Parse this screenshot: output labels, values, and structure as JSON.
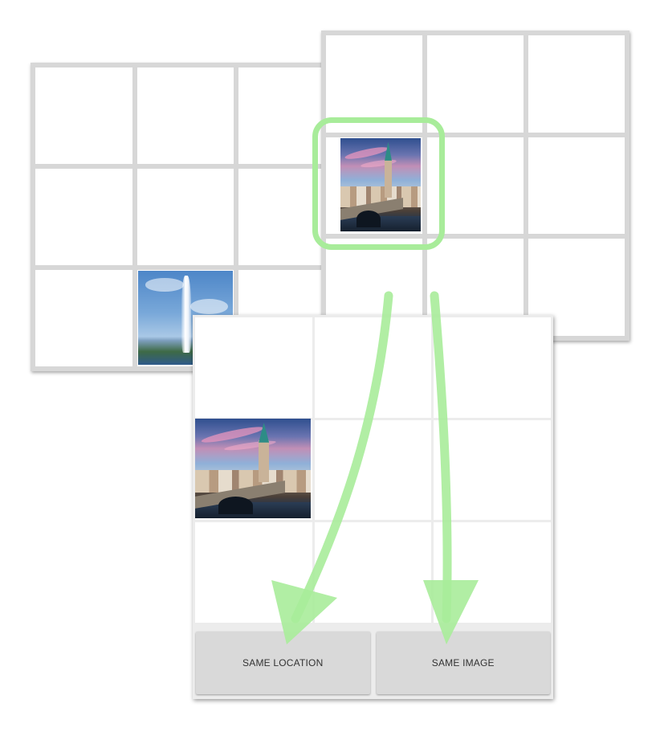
{
  "buttons": {
    "same_location_label": "SAME LOCATION",
    "same_image_label": "SAME IMAGE"
  },
  "colors": {
    "highlight": "#a8ec9a",
    "board_border": "#d7d7d7",
    "button_bg": "#d9d9d9"
  },
  "boards": {
    "left": {
      "rows": 3,
      "cols": 3,
      "image_cell": "row 3, col 2",
      "image": "fountain-photo"
    },
    "right": {
      "rows": 3,
      "cols": 3,
      "image_cell": "row 2, col 1",
      "image": "zurich-church-photo"
    },
    "front": {
      "rows": 3,
      "cols": 3,
      "image_cell": "row 2, col 1",
      "image": "zurich-church-photo"
    }
  }
}
